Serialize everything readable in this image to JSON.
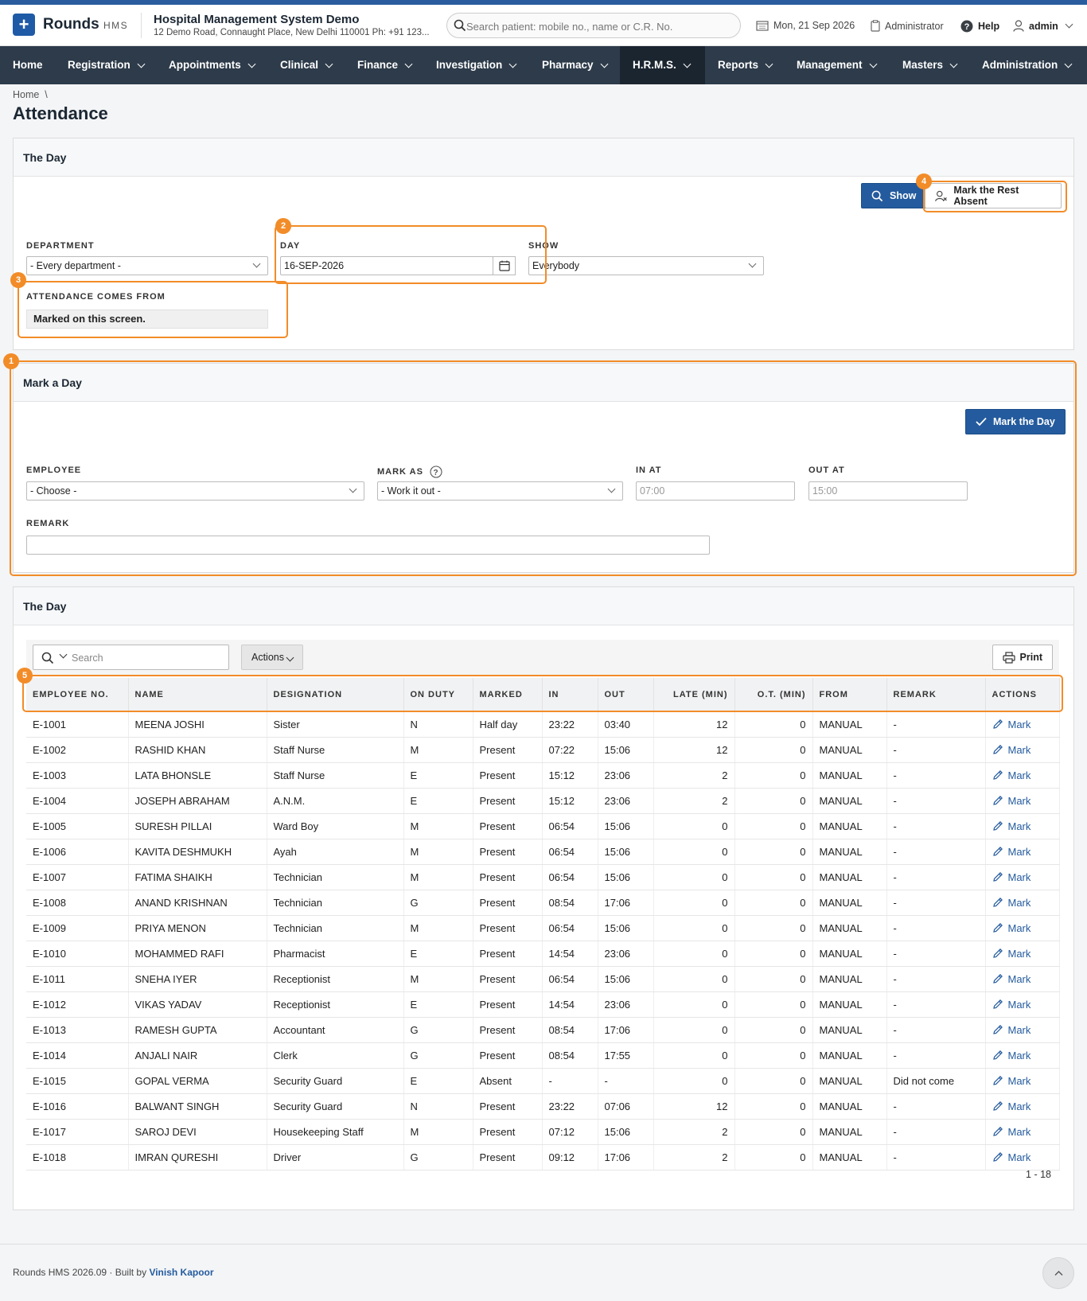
{
  "app": {
    "name": "Rounds",
    "sub": "HMS"
  },
  "hospital": {
    "name": "Hospital Management System Demo",
    "address": "12 Demo Road, Connaught Place, New Delhi 110001 Ph: +91 123..."
  },
  "search": {
    "placeholder": "Search patient: mobile no., name or C.R. No."
  },
  "header": {
    "date": "Mon, 21 Sep 2026",
    "role": "Administrator",
    "help": "Help",
    "user": "admin"
  },
  "nav": [
    "Home",
    "Registration",
    "Appointments",
    "Clinical",
    "Finance",
    "Investigation",
    "Pharmacy",
    "H.R.M.S.",
    "Reports",
    "Management",
    "Masters",
    "Administration"
  ],
  "breadcrumb": {
    "home": "Home",
    "sep": "\\"
  },
  "page_title": "Attendance",
  "panel1": {
    "title": "The Day",
    "show_button": "Show",
    "mark_rest_button": "Mark the Rest Absent",
    "department_label": "DEPARTMENT",
    "department_value": "- Every department -",
    "day_label": "DAY",
    "day_value": "16-SEP-2026",
    "show_label": "SHOW",
    "show_value": "Everybody",
    "source_label": "ATTENDANCE COMES FROM",
    "source_value": "Marked on this screen."
  },
  "panel2": {
    "title": "Mark a Day",
    "mark_button": "Mark the Day",
    "employee_label": "EMPLOYEE",
    "employee_value": "- Choose -",
    "markas_label": "MARK AS",
    "markas_value": "- Work it out -",
    "inat_label": "IN AT",
    "inat_placeholder": "07:00",
    "outat_label": "OUT AT",
    "outat_placeholder": "15:00",
    "remark_label": "REMARK"
  },
  "badges": [
    "1",
    "2",
    "3",
    "4",
    "5"
  ],
  "panel3": {
    "title": "The Day",
    "search_placeholder": "Search",
    "actions_label": "Actions",
    "print_label": "Print",
    "pager": "1 - 18",
    "columns": [
      "EMPLOYEE NO.",
      "NAME",
      "DESIGNATION",
      "ON DUTY",
      "MARKED",
      "IN",
      "OUT",
      "LATE (MIN)",
      "O.T. (MIN)",
      "FROM",
      "REMARK",
      "ACTIONS"
    ],
    "action_label": "Mark",
    "rows": [
      [
        "E-1001",
        "MEENA JOSHI",
        "Sister",
        "N",
        "Half day",
        "23:22",
        "03:40",
        "12",
        "0",
        "MANUAL",
        "-"
      ],
      [
        "E-1002",
        "RASHID KHAN",
        "Staff Nurse",
        "M",
        "Present",
        "07:22",
        "15:06",
        "12",
        "0",
        "MANUAL",
        "-"
      ],
      [
        "E-1003",
        "LATA BHONSLE",
        "Staff Nurse",
        "E",
        "Present",
        "15:12",
        "23:06",
        "2",
        "0",
        "MANUAL",
        "-"
      ],
      [
        "E-1004",
        "JOSEPH ABRAHAM",
        "A.N.M.",
        "E",
        "Present",
        "15:12",
        "23:06",
        "2",
        "0",
        "MANUAL",
        "-"
      ],
      [
        "E-1005",
        "SURESH PILLAI",
        "Ward Boy",
        "M",
        "Present",
        "06:54",
        "15:06",
        "0",
        "0",
        "MANUAL",
        "-"
      ],
      [
        "E-1006",
        "KAVITA DESHMUKH",
        "Ayah",
        "M",
        "Present",
        "06:54",
        "15:06",
        "0",
        "0",
        "MANUAL",
        "-"
      ],
      [
        "E-1007",
        "FATIMA SHAIKH",
        "Technician",
        "M",
        "Present",
        "06:54",
        "15:06",
        "0",
        "0",
        "MANUAL",
        "-"
      ],
      [
        "E-1008",
        "ANAND KRISHNAN",
        "Technician",
        "G",
        "Present",
        "08:54",
        "17:06",
        "0",
        "0",
        "MANUAL",
        "-"
      ],
      [
        "E-1009",
        "PRIYA MENON",
        "Technician",
        "M",
        "Present",
        "06:54",
        "15:06",
        "0",
        "0",
        "MANUAL",
        "-"
      ],
      [
        "E-1010",
        "MOHAMMED RAFI",
        "Pharmacist",
        "E",
        "Present",
        "14:54",
        "23:06",
        "0",
        "0",
        "MANUAL",
        "-"
      ],
      [
        "E-1011",
        "SNEHA IYER",
        "Receptionist",
        "M",
        "Present",
        "06:54",
        "15:06",
        "0",
        "0",
        "MANUAL",
        "-"
      ],
      [
        "E-1012",
        "VIKAS YADAV",
        "Receptionist",
        "E",
        "Present",
        "14:54",
        "23:06",
        "0",
        "0",
        "MANUAL",
        "-"
      ],
      [
        "E-1013",
        "RAMESH GUPTA",
        "Accountant",
        "G",
        "Present",
        "08:54",
        "17:06",
        "0",
        "0",
        "MANUAL",
        "-"
      ],
      [
        "E-1014",
        "ANJALI NAIR",
        "Clerk",
        "G",
        "Present",
        "08:54",
        "17:55",
        "0",
        "0",
        "MANUAL",
        "-"
      ],
      [
        "E-1015",
        "GOPAL VERMA",
        "Security Guard",
        "E",
        "Absent",
        "-",
        "-",
        "0",
        "0",
        "MANUAL",
        "Did not come"
      ],
      [
        "E-1016",
        "BALWANT SINGH",
        "Security Guard",
        "N",
        "Present",
        "23:22",
        "07:06",
        "12",
        "0",
        "MANUAL",
        "-"
      ],
      [
        "E-1017",
        "SAROJ DEVI",
        "Housekeeping Staff",
        "M",
        "Present",
        "07:12",
        "15:06",
        "2",
        "0",
        "MANUAL",
        "-"
      ],
      [
        "E-1018",
        "IMRAN QURESHI",
        "Driver",
        "G",
        "Present",
        "09:12",
        "17:06",
        "2",
        "0",
        "MANUAL",
        "-"
      ]
    ]
  },
  "footer": {
    "text": "Rounds HMS 2026.09 · Built by",
    "author": "Vinish Kapoor"
  },
  "colors": {
    "brand": "#1f5aa6",
    "nav_bg": "#2d3b4a",
    "highlight": "#f28c28",
    "primary_button": "#245b9e"
  }
}
